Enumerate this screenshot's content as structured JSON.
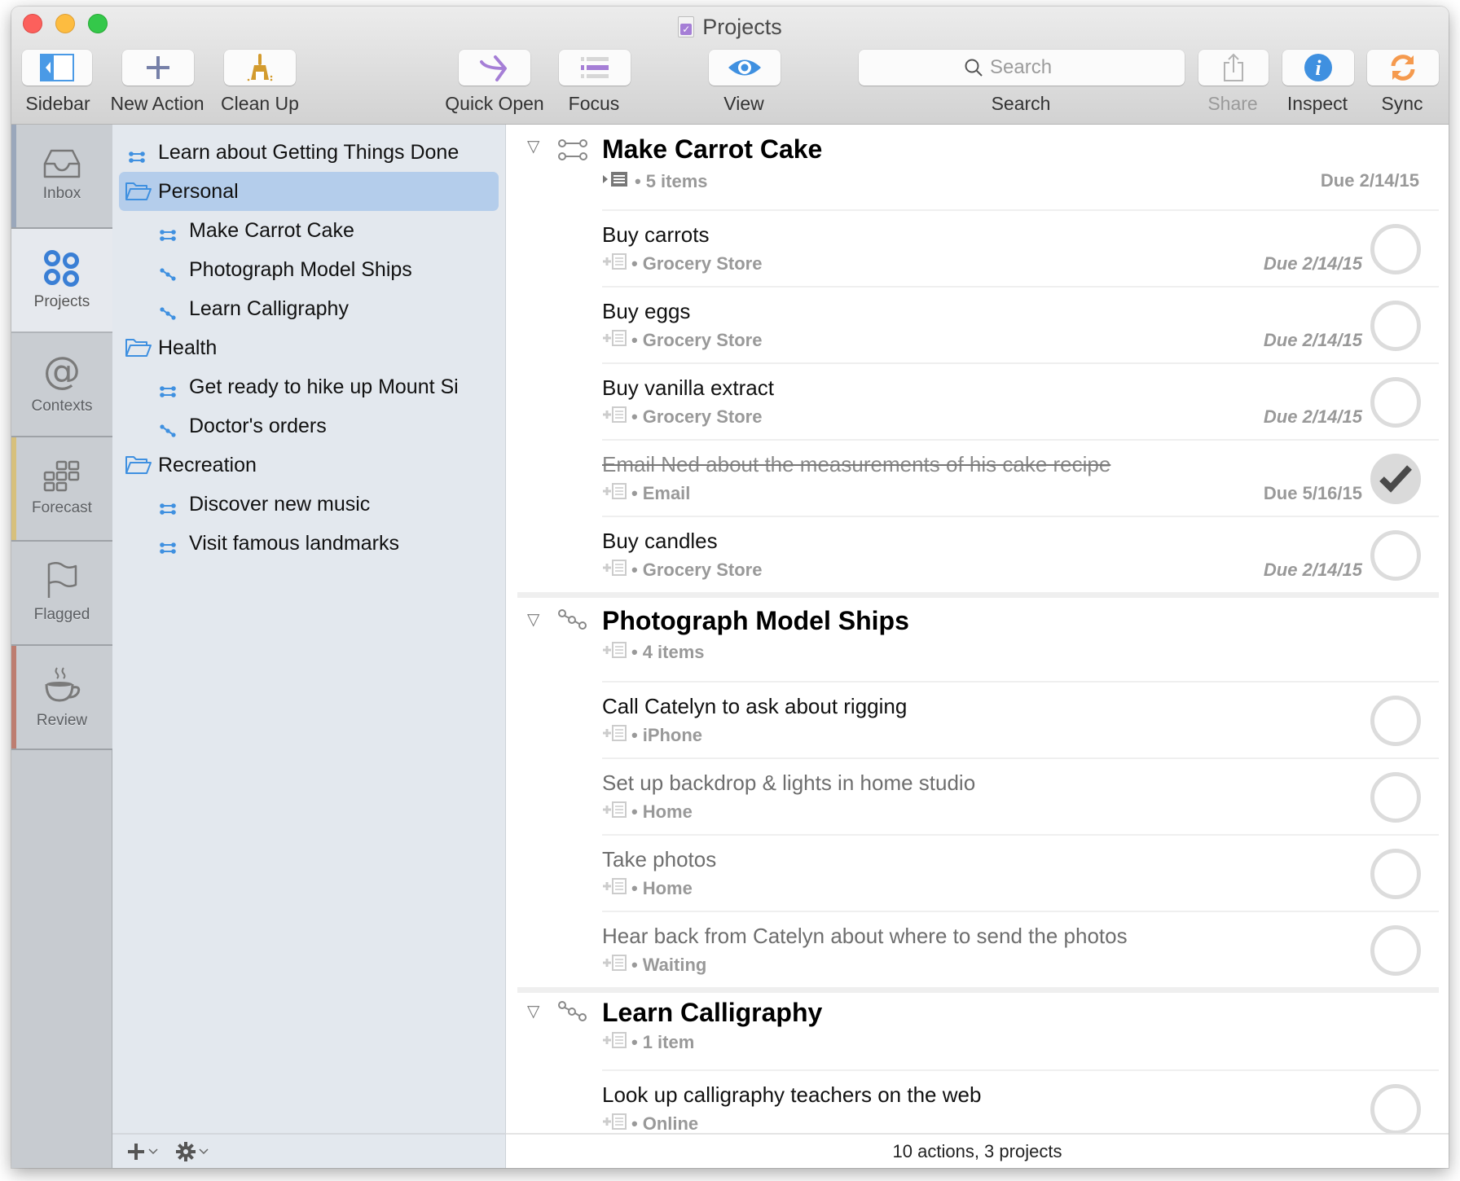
{
  "window": {
    "title": "Projects",
    "title_icon": "omnifocus-document-icon"
  },
  "toolbar": {
    "sidebar_label": "Sidebar",
    "new_action_label": "New Action",
    "clean_up_label": "Clean Up",
    "quick_open_label": "Quick Open",
    "focus_label": "Focus",
    "view_label": "View",
    "search_placeholder": "Search",
    "search_label": "Search",
    "share_label": "Share",
    "inspect_label": "Inspect",
    "sync_label": "Sync"
  },
  "colors": {
    "accent_blue": "#4a90d9",
    "selection": "#b4cdeb",
    "quick_open_purple": "#a57ed6",
    "clean_up_gold": "#d39b2e",
    "sync_orange": "#f59a4e",
    "forecast_stripe": "#d7c07c",
    "review_stripe": "#bd7d70",
    "inbox_stripe": "#9aa7bb"
  },
  "perspectives": [
    {
      "label": "Inbox",
      "icon": "inbox-tray-icon",
      "selected": false
    },
    {
      "label": "Projects",
      "icon": "projects-circles-icon",
      "selected": true
    },
    {
      "label": "Contexts",
      "icon": "at-sign-icon",
      "selected": false
    },
    {
      "label": "Forecast",
      "icon": "calendar-grid-icon",
      "selected": false
    },
    {
      "label": "Flagged",
      "icon": "flag-icon",
      "selected": false
    },
    {
      "label": "Review",
      "icon": "coffee-cup-icon",
      "selected": false
    }
  ],
  "outline": [
    {
      "label": "Learn about Getting Things Done",
      "type": "parallel-project",
      "level": 0
    },
    {
      "label": "Personal",
      "type": "folder",
      "level": 0,
      "selected": true
    },
    {
      "label": "Make Carrot Cake",
      "type": "parallel-project",
      "level": 1
    },
    {
      "label": "Photograph Model Ships",
      "type": "sequential-project",
      "level": 1
    },
    {
      "label": "Learn Calligraphy",
      "type": "sequential-project",
      "level": 1
    },
    {
      "label": "Health",
      "type": "folder",
      "level": 0
    },
    {
      "label": "Get ready to hike up Mount Si",
      "type": "parallel-project",
      "level": 1
    },
    {
      "label": "Doctor's orders",
      "type": "sequential-project",
      "level": 1
    },
    {
      "label": "Recreation",
      "type": "folder",
      "level": 0
    },
    {
      "label": "Discover new music",
      "type": "parallel-project",
      "level": 1
    },
    {
      "label": "Visit famous landmarks",
      "type": "parallel-project",
      "level": 1
    }
  ],
  "projects": [
    {
      "title": "Make Carrot Cake",
      "type": "parallel",
      "count": "5 items",
      "due": "Due 2/14/15",
      "has_note": true,
      "actions": [
        {
          "name": "Buy carrots",
          "context": "Grocery Store",
          "due": "Due 2/14/15",
          "state": "available"
        },
        {
          "name": "Buy eggs",
          "context": "Grocery Store",
          "due": "Due 2/14/15",
          "state": "available"
        },
        {
          "name": "Buy vanilla extract",
          "context": "Grocery Store",
          "due": "Due 2/14/15",
          "state": "available"
        },
        {
          "name": "Email Ned about the measurements of his cake recipe",
          "context": "Email",
          "due": "Due 5/16/15",
          "state": "completed"
        },
        {
          "name": "Buy candles",
          "context": "Grocery Store",
          "due": "Due 2/14/15",
          "state": "available"
        }
      ]
    },
    {
      "title": "Photograph Model Ships",
      "type": "sequential",
      "count": "4 items",
      "due": "",
      "has_note": false,
      "actions": [
        {
          "name": "Call Catelyn to ask about rigging",
          "context": "iPhone",
          "due": "",
          "state": "available"
        },
        {
          "name": "Set up backdrop & lights in home studio",
          "context": "Home",
          "due": "",
          "state": "blocked"
        },
        {
          "name": "Take photos",
          "context": "Home",
          "due": "",
          "state": "blocked"
        },
        {
          "name": "Hear back from Catelyn about where to send the photos",
          "context": "Waiting",
          "due": "",
          "state": "blocked"
        }
      ]
    },
    {
      "title": "Learn Calligraphy",
      "type": "sequential",
      "count": "1 item",
      "due": "",
      "has_note": false,
      "actions": [
        {
          "name": "Look up calligraphy teachers on the web",
          "context": "Online",
          "due": "",
          "state": "available"
        }
      ]
    }
  ],
  "meta_separator": "•",
  "status": {
    "summary": "10 actions, 3 projects",
    "add_menu_icon": "plus-icon",
    "settings_menu_icon": "gear-icon"
  }
}
